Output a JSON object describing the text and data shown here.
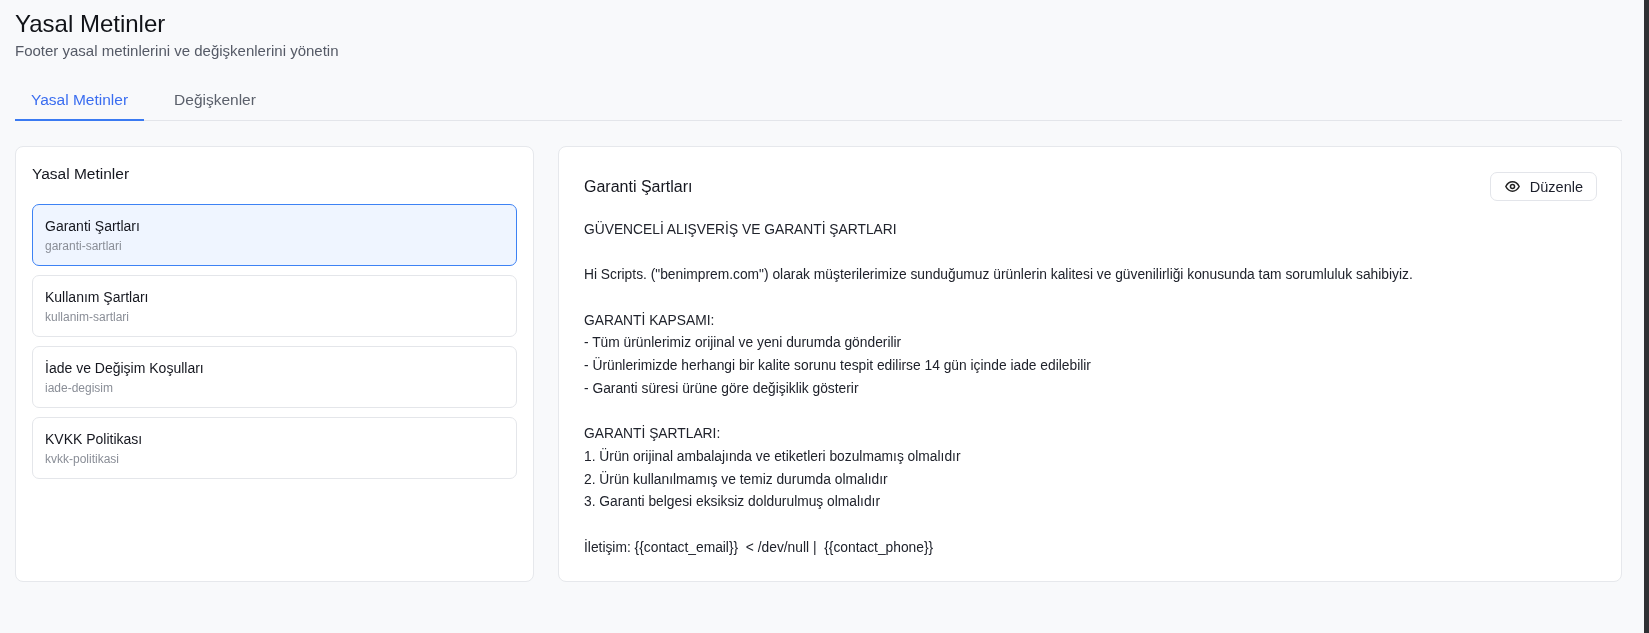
{
  "page": {
    "title": "Yasal Metinler",
    "subtitle": "Footer yasal metinlerini ve değişkenlerini yönetin"
  },
  "tabs": [
    {
      "label": "Yasal Metinler",
      "selected": true
    },
    {
      "label": "Değişkenler",
      "selected": false
    }
  ],
  "document_list": {
    "title": "Yasal Metinler",
    "items": [
      {
        "title": "Garanti Şartları",
        "slug": "garanti-sartlari",
        "selected": true
      },
      {
        "title": "Kullanım Şartları",
        "slug": "kullanim-sartlari",
        "selected": false
      },
      {
        "title": "İade ve Değişim Koşulları",
        "slug": "iade-degisim",
        "selected": false
      },
      {
        "title": "KVKK Politikası",
        "slug": "kvkk-politikasi",
        "selected": false
      }
    ]
  },
  "preview": {
    "title": "Garanti Şartları",
    "edit_button": "Düzenle",
    "paragraphs": [
      {
        "lines": [
          "GÜVENCELİ ALIŞVERİŞ VE GARANTİ ŞARTLARI"
        ]
      },
      {
        "lines": [
          "Hi Scripts. (\"benimprem.com\") olarak müşterilerimize sunduğumuz ürünlerin kalitesi ve güvenilirliği konusunda tam sorumluluk sahibiyiz."
        ]
      },
      {
        "lines": [
          "GARANTİ KAPSAMI:",
          "- Tüm ürünlerimiz orijinal ve yeni durumda gönderilir",
          "- Ürünlerimizde herhangi bir kalite sorunu tespit edilirse 14 gün içinde iade edilebilir",
          "- Garanti süresi ürüne göre değişiklik gösterir"
        ]
      },
      {
        "lines": [
          "GARANTİ ŞARTLARI:",
          "1. Ürün orijinal ambalajında ve etiketleri bozulmamış olmalıdır",
          "2. Ürün kullanılmamış ve temiz durumda olmalıdır",
          "3. Garanti belgesi eksiksiz doldurulmuş olmalıdır"
        ]
      },
      {
        "lines": [
          "İletişim: {{contact_email}}  < /dev/null |  {{contact_phone}}"
        ]
      }
    ]
  }
}
